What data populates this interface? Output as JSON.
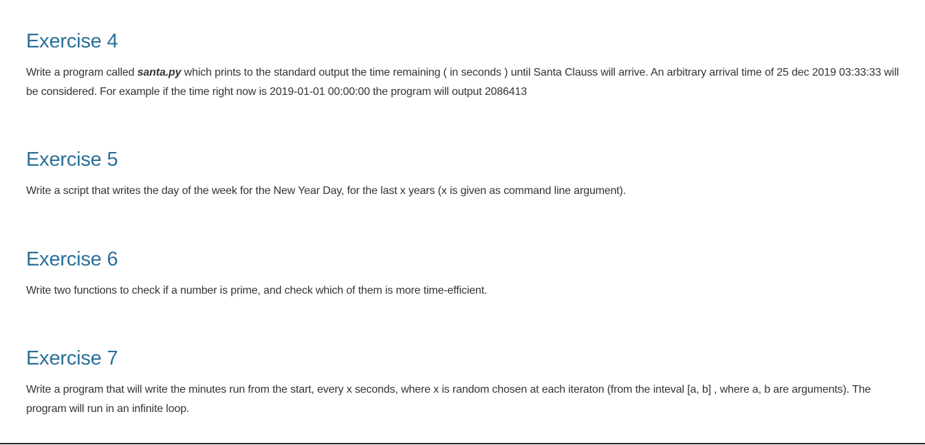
{
  "exercises": [
    {
      "title": "Exercise 4",
      "text_before": "Write a program called ",
      "filename": "santa.py",
      "text_after": " which prints to the standard output the time remaining ( in seconds ) until Santa Clauss will arrive. An arbitrary arrival time of 25 dec 2019 03:33:33 will be considered. For example if the time right now is 2019-01-01 00:00:00 the program will output 2086413"
    },
    {
      "title": "Exercise 5",
      "text": "Write a script that writes the day of the week for the New Year Day, for the last x years (x is given as command line argument)."
    },
    {
      "title": "Exercise 6",
      "text": "Write two functions to check if a number is prime, and check which of them is more time-efficient."
    },
    {
      "title": "Exercise 7",
      "text": "Write a program that will write the minutes run from the start, every x seconds, where x is random chosen at each iteraton (from the inteval [a, b] , where a, b are arguments). The program will run in an infinite loop."
    }
  ]
}
